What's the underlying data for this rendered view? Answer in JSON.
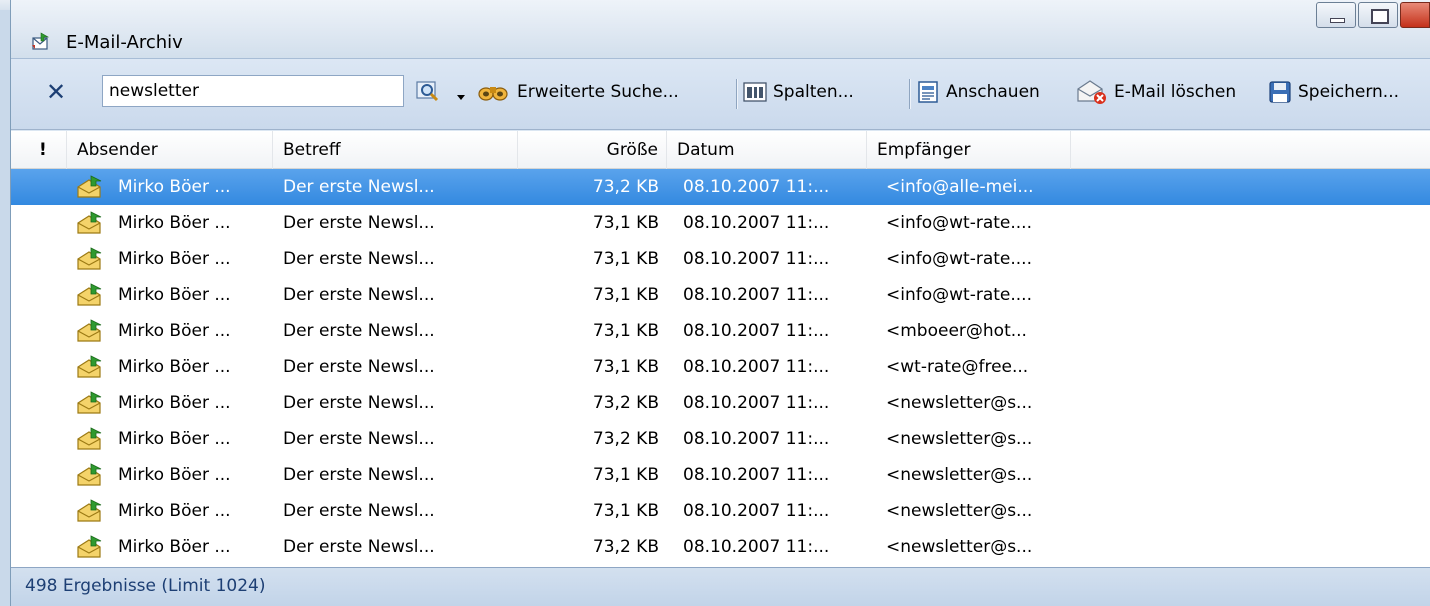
{
  "window": {
    "title": "E-Mail-Archiv"
  },
  "toolbar": {
    "clear_label": "✕",
    "search_value": "newsletter",
    "advanced_search_label": "Erweiterte Suche...",
    "columns_label": "Spalten...",
    "view_label": "Anschauen",
    "delete_label": "E-Mail löschen",
    "save_label": "Speichern..."
  },
  "list": {
    "columns": {
      "flag": "!",
      "sender": "Absender",
      "subject": "Betreff",
      "size": "Größe",
      "date": "Datum",
      "recipient": "Empfänger"
    },
    "rows": [
      {
        "sender": "Mirko Böer ...",
        "subject": "Der erste Newsl...",
        "size": "73,2 KB",
        "date": "08.10.2007 11:...",
        "recipient": "<info@alle-mei..."
      },
      {
        "sender": "Mirko Böer ...",
        "subject": "Der erste Newsl...",
        "size": "73,1 KB",
        "date": "08.10.2007 11:...",
        "recipient": "<info@wt-rate...."
      },
      {
        "sender": "Mirko Böer ...",
        "subject": "Der erste Newsl...",
        "size": "73,1 KB",
        "date": "08.10.2007 11:...",
        "recipient": "<info@wt-rate...."
      },
      {
        "sender": "Mirko Böer ...",
        "subject": "Der erste Newsl...",
        "size": "73,1 KB",
        "date": "08.10.2007 11:...",
        "recipient": "<info@wt-rate...."
      },
      {
        "sender": "Mirko Böer ...",
        "subject": "Der erste Newsl...",
        "size": "73,1 KB",
        "date": "08.10.2007 11:...",
        "recipient": "<mboeer@hot..."
      },
      {
        "sender": "Mirko Böer ...",
        "subject": "Der erste Newsl...",
        "size": "73,1 KB",
        "date": "08.10.2007 11:...",
        "recipient": "<wt-rate@free..."
      },
      {
        "sender": "Mirko Böer ...",
        "subject": "Der erste Newsl...",
        "size": "73,2 KB",
        "date": "08.10.2007 11:...",
        "recipient": "<newsletter@s..."
      },
      {
        "sender": "Mirko Böer ...",
        "subject": "Der erste Newsl...",
        "size": "73,2 KB",
        "date": "08.10.2007 11:...",
        "recipient": "<newsletter@s..."
      },
      {
        "sender": "Mirko Böer ...",
        "subject": "Der erste Newsl...",
        "size": "73,1 KB",
        "date": "08.10.2007 11:...",
        "recipient": "<newsletter@s..."
      },
      {
        "sender": "Mirko Böer ...",
        "subject": "Der erste Newsl...",
        "size": "73,1 KB",
        "date": "08.10.2007 11:...",
        "recipient": "<newsletter@s..."
      },
      {
        "sender": "Mirko Böer ...",
        "subject": "Der erste Newsl...",
        "size": "73,2 KB",
        "date": "08.10.2007 11:...",
        "recipient": "<newsletter@s..."
      }
    ],
    "selected_index": 0
  },
  "status": {
    "results_text": "498 Ergebnisse (Limit 1024)"
  },
  "colors": {
    "selection": "#3389e0",
    "status_text": "#1d3f74"
  },
  "icons": {
    "app": "email-archive-icon",
    "row": "mail-read-icon"
  }
}
